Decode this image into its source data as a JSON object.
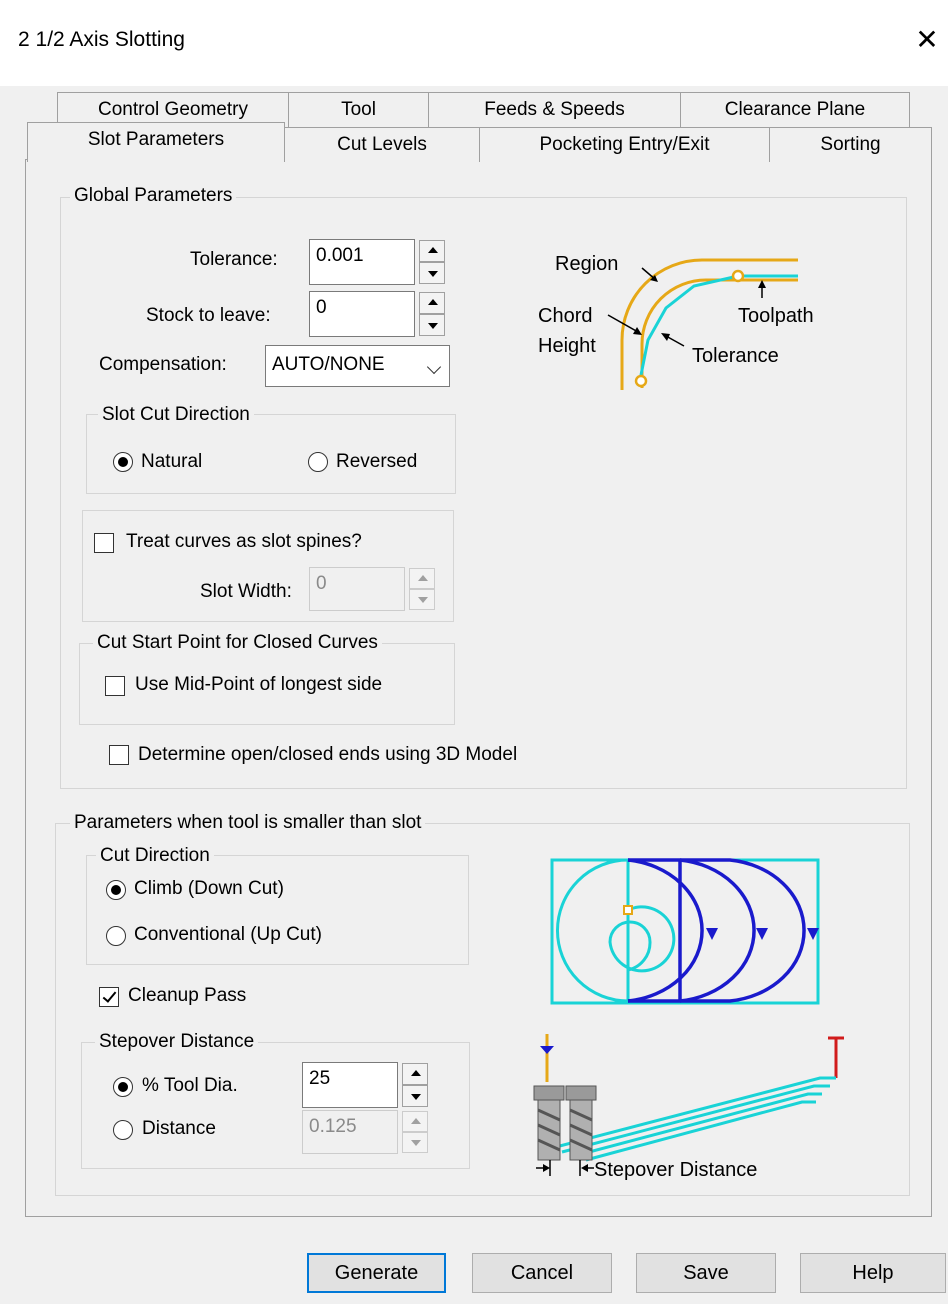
{
  "window": {
    "title": "2 1/2 Axis Slotting"
  },
  "tabs": {
    "row1": [
      "Control Geometry",
      "Tool",
      "Feeds & Speeds",
      "Clearance Plane"
    ],
    "row2": [
      "Slot Parameters",
      "Cut Levels",
      "Pocketing Entry/Exit",
      "Sorting"
    ],
    "active": "Slot Parameters"
  },
  "global": {
    "legend": "Global Parameters",
    "tolerance_label": "Tolerance:",
    "tolerance_value": "0.001",
    "stock_label": "Stock to leave:",
    "stock_value": "0",
    "compensation_label": "Compensation:",
    "compensation_value": "AUTO/NONE",
    "slot_dir_legend": "Slot Cut Direction",
    "natural_label": "Natural",
    "reversed_label": "Reversed",
    "selected_direction": "Natural",
    "treat_curves_label": "Treat curves as slot spines?",
    "treat_curves_checked": false,
    "slot_width_label": "Slot Width:",
    "slot_width_value": "0",
    "cut_start_legend": "Cut Start Point for Closed Curves",
    "mid_point_label": "Use Mid-Point of longest side",
    "mid_point_checked": false,
    "determine_label": "Determine open/closed ends using 3D Model",
    "determine_checked": false
  },
  "diagram1": {
    "region": "Region",
    "toolpath": "Toolpath",
    "chord": "Chord",
    "height": "Height",
    "tolerance": "Tolerance",
    "colors": {
      "region": "#e6a817",
      "toolpath": "#19d3d6",
      "arrow": "#000000"
    }
  },
  "smaller": {
    "legend": "Parameters when tool is smaller than slot",
    "cut_dir_legend": "Cut Direction",
    "climb_label": "Climb (Down Cut)",
    "conventional_label": "Conventional (Up Cut)",
    "selected_cut": "Climb (Down Cut)",
    "cleanup_label": "Cleanup Pass",
    "cleanup_checked": true,
    "stepover_legend": "Stepover Distance",
    "tooldia_label": "% Tool Dia.",
    "tooldia_value": "25",
    "distance_label": "Distance",
    "distance_value": "0.125",
    "selected_stepover": "% Tool Dia."
  },
  "diagram2": {
    "stepover_caption": "Stepover Distance",
    "colors": {
      "slot": "#19d3d6",
      "path": "#1a1acc",
      "tool_marker": "#e6a817",
      "clearance": "#d11b1b"
    }
  },
  "buttons": {
    "generate": "Generate",
    "cancel": "Cancel",
    "save": "Save",
    "help": "Help"
  }
}
